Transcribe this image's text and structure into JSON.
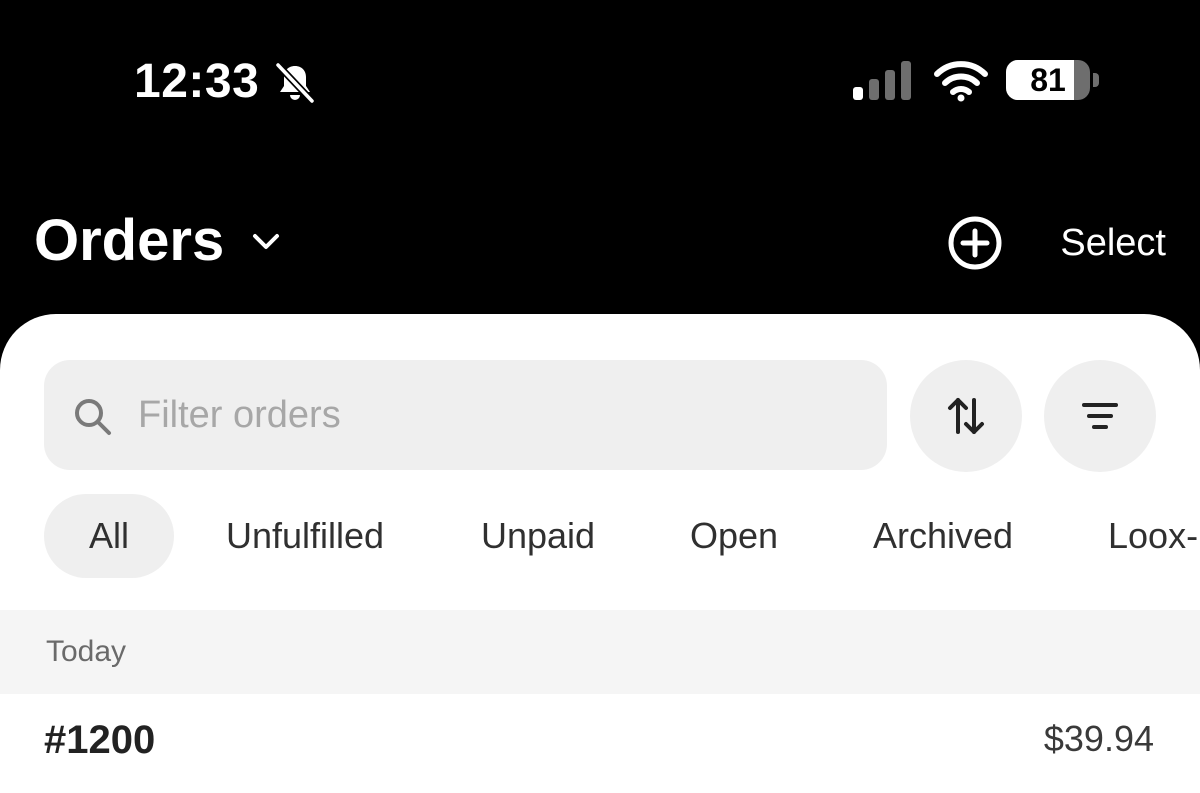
{
  "status_bar": {
    "time": "12:33",
    "battery_percent": "81",
    "battery_level": 0.81,
    "icons": [
      "bell-slash-icon",
      "cellular-signal-icon",
      "wifi-icon",
      "battery-icon"
    ]
  },
  "header": {
    "title": "Orders",
    "select_label": "Select",
    "icons": [
      "chevron-down-icon",
      "plus-circle-icon"
    ]
  },
  "search": {
    "placeholder": "Filter orders",
    "value": ""
  },
  "toolbar_icons": [
    "sort-arrows-icon",
    "filter-lines-icon"
  ],
  "tabs": [
    {
      "label": "All",
      "active": true
    },
    {
      "label": "Unfulfilled",
      "active": false
    },
    {
      "label": "Unpaid",
      "active": false
    },
    {
      "label": "Open",
      "active": false
    },
    {
      "label": "Archived",
      "active": false
    },
    {
      "label": "Loox-",
      "active": false
    }
  ],
  "section": {
    "label": "Today"
  },
  "orders": [
    {
      "id": "#1200",
      "total": "$39.94"
    }
  ],
  "colors": {
    "background": "#000000",
    "sheet": "#ffffff",
    "chip": "#efefef",
    "section_band": "#f5f5f5"
  }
}
